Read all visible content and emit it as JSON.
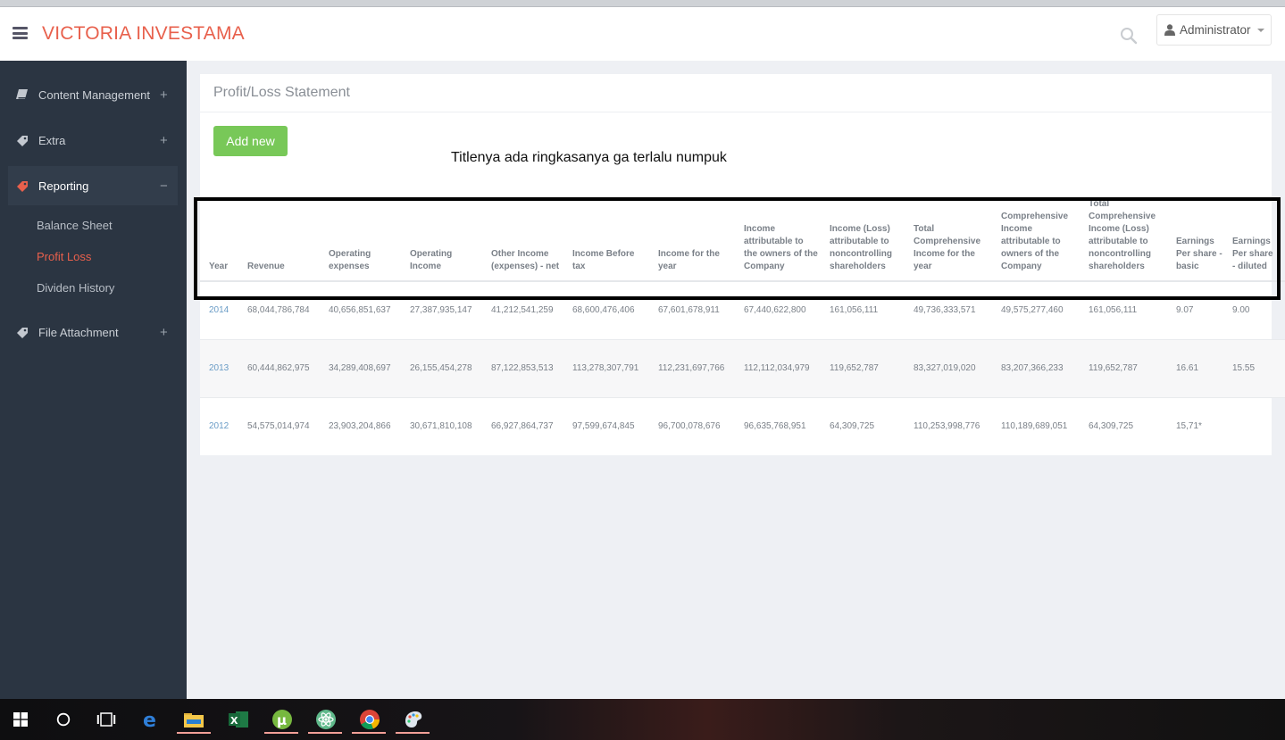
{
  "app": {
    "brand": "VICTORIA INVESTAMA",
    "user_label": "Administrator"
  },
  "sidebar": {
    "items": [
      {
        "label": "Content Management",
        "toggle": "+",
        "icon": "book-icon"
      },
      {
        "label": "Extra",
        "toggle": "+",
        "icon": "tag-icon"
      },
      {
        "label": "Reporting",
        "toggle": "−",
        "icon": "tag-icon"
      },
      {
        "label": "File Attachment",
        "toggle": "+",
        "icon": "tag-icon"
      }
    ],
    "sub_items": [
      "Balance Sheet",
      "Profit Loss",
      "Dividen History"
    ]
  },
  "page": {
    "title": "Profit/Loss Statement",
    "add_button": "Add new",
    "note": "Titlenya ada ringkasanya ga terlalu numpuk"
  },
  "table": {
    "headers": [
      "Year",
      "Revenue",
      "Operating expenses",
      "Operating Income",
      "Other Income (expenses) - net",
      "Income Before tax",
      "Income for the year",
      "Income attributable to the owners of the Company",
      "Income (Loss) attributable to noncontrolling shareholders",
      "Total Comprehensive Income for the year",
      "Comprehensive Income attributable to owners of the Company",
      "Total Comprehensive Income (Loss) attributable to noncontrolling shareholders",
      "Earnings Per share - basic",
      "Earnings Per share - diluted"
    ],
    "rows": [
      [
        "2014",
        "68,044,786,784",
        "40,656,851,637",
        "27,387,935,147",
        "41,212,541,259",
        "68,600,476,406",
        "67,601,678,911",
        "67,440,622,800",
        "161,056,111",
        "49,736,333,571",
        "49,575,277,460",
        "161,056,111",
        "9.07",
        "9.00"
      ],
      [
        "2013",
        "60,444,862,975",
        "34,289,408,697",
        "26,155,454,278",
        "87,122,853,513",
        "113,278,307,791",
        "112,231,697,766",
        "112,112,034,979",
        "119,652,787",
        "83,327,019,020",
        "83,207,366,233",
        "119,652,787",
        "16.61",
        "15.55"
      ],
      [
        "2012",
        "54,575,014,974",
        "23,903,204,866",
        "30,671,810,108",
        "66,927,864,737",
        "97,599,674,845",
        "96,700,078,676",
        "96,635,768,951",
        "64,309,725",
        "110,253,998,776",
        "110,189,689,051",
        "64,309,725",
        "15,71*",
        ""
      ]
    ]
  },
  "taskbar": {
    "icons": [
      "windows-start-icon",
      "cortana-search-icon",
      "task-view-icon",
      "edge-icon",
      "file-explorer-icon",
      "excel-icon",
      "utorrent-icon",
      "atom-icon",
      "chrome-icon",
      "paint-icon"
    ]
  },
  "colors": {
    "brand": "#e8604c",
    "sidebar": "#2b3542",
    "add_button": "#78c858",
    "year_link": "#6a9cc6"
  }
}
